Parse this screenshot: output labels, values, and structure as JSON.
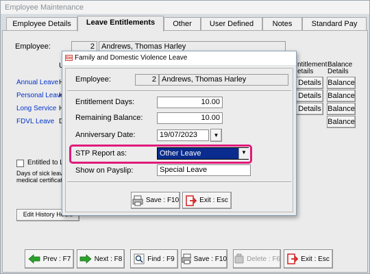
{
  "window": {
    "title": "Employee Maintenance"
  },
  "tabs": [
    {
      "label": "Employee Details"
    },
    {
      "label": "Leave Entitlements"
    },
    {
      "label": "Other"
    },
    {
      "label": "User Defined"
    },
    {
      "label": "Notes"
    },
    {
      "label": "Standard Pay"
    }
  ],
  "employee": {
    "label": "Employee:",
    "number": "2",
    "name": "Andrews, Thomas  Harley"
  },
  "columns": {
    "u": "U",
    "entitlement": "ntitlement",
    "entitlement2": "etails",
    "balance": "Balance",
    "balance2": "Details"
  },
  "leave_rows": [
    {
      "name": "Annual Leave",
      "type": "H",
      "details": "Details",
      "balance": "Balance"
    },
    {
      "name": "Personal Leave",
      "type": "H",
      "details": "Details",
      "balance": "Balance"
    },
    {
      "name": "Long Service",
      "type": "H",
      "details": "Details",
      "balance": "Balance"
    },
    {
      "name": "FDVL Leave",
      "type": "D",
      "details": "",
      "balance": "Balance"
    }
  ],
  "left_panel": {
    "entitled_label": "Entitled to Leav",
    "sick_note_1": "Days of sick leave",
    "sick_note_2": "medical certificate",
    "history_button": "Edit History Hours"
  },
  "bottom_buttons": {
    "prev": "Prev : F7",
    "next": "Next : F8",
    "find": "Find : F9",
    "save": "Save : F10",
    "delete": "Delete : F6",
    "exit": "Exit : Esc"
  },
  "dialog": {
    "title": "Family and Domestic Violence Leave",
    "icon_text": "Exo",
    "employee_label": "Employee:",
    "employee_number": "2",
    "employee_name": "Andrews, Thomas  Harley",
    "entitlement_label": "Entitlement Days:",
    "entitlement_value": "10.00",
    "remaining_label": "Remaining Balance:",
    "remaining_value": "10.00",
    "anniversary_label": "Anniversary Date:",
    "anniversary_value": "19/07/2023",
    "stp_label": "STP Report as:",
    "stp_value": "Other Leave",
    "payslip_label": "Show on Payslip:",
    "payslip_value": "Special Leave",
    "save_label": "Save : F10",
    "exit_label": "Exit : Esc"
  },
  "colors": {
    "highlight": "#e0197a",
    "selection": "#0a2c8e",
    "link_blue": "#0033cc"
  }
}
